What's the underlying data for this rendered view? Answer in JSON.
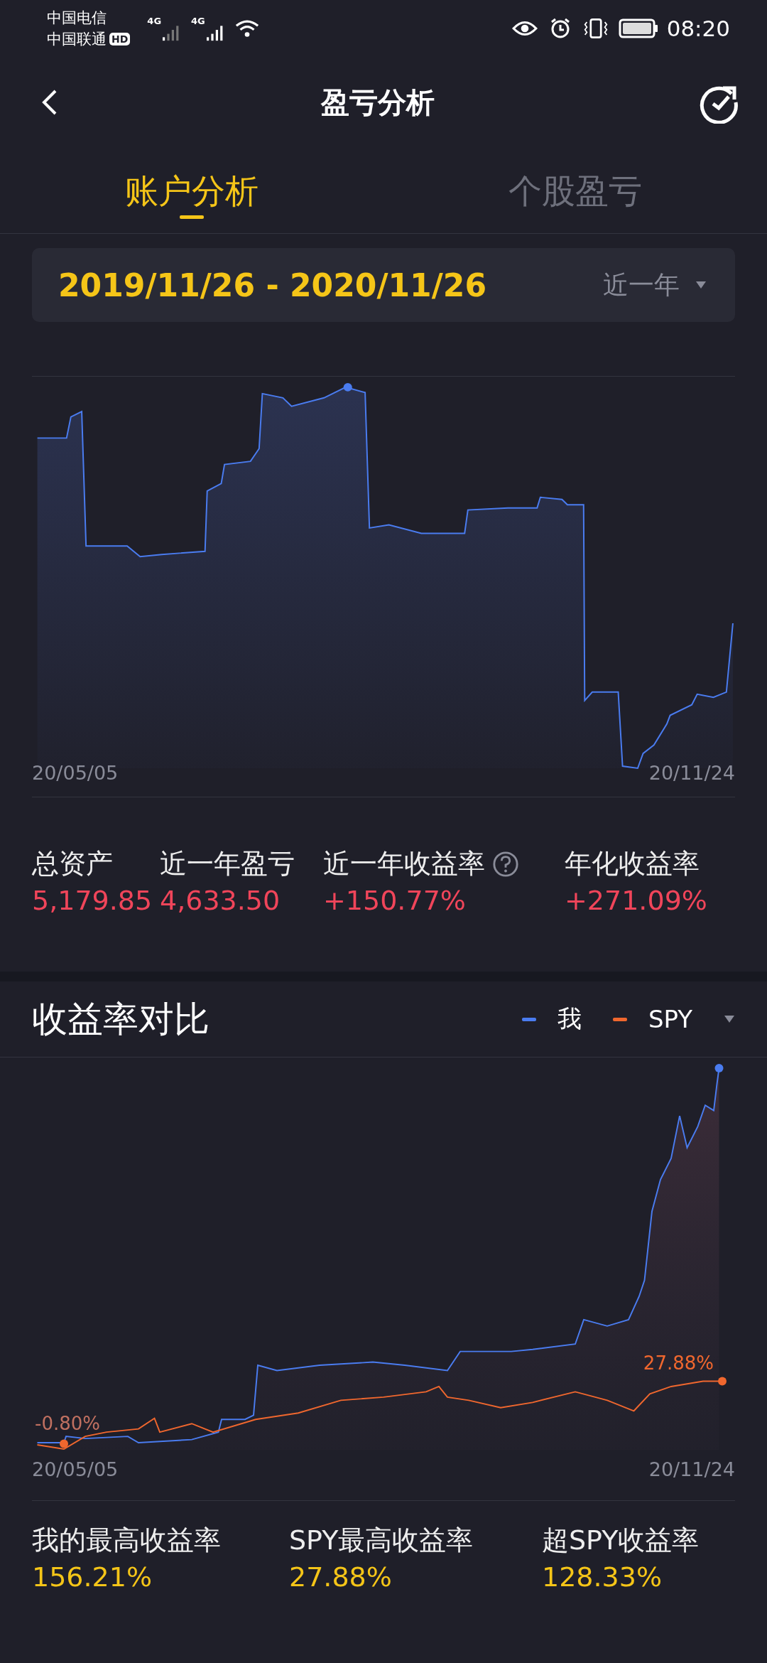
{
  "status_bar": {
    "carrier_1": "中国电信",
    "carrier_2": "中国联通",
    "hd_badge": "HD",
    "network_1": "4G",
    "network_2": "4G",
    "time": "08:20"
  },
  "header": {
    "title": "盈亏分析"
  },
  "tabs": [
    {
      "label": "账户分析",
      "selected": true
    },
    {
      "label": "个股盈亏",
      "selected": false
    }
  ],
  "date_range": {
    "range": "2019/11/26 - 2020/11/26",
    "period": "近一年"
  },
  "account_chart": {
    "x_start": "20/05/05",
    "x_end": "20/11/24"
  },
  "account_stats": [
    {
      "label": "总资产",
      "value": "5,179.85",
      "help": false
    },
    {
      "label": "近一年盈亏",
      "value": "4,633.50",
      "help": false
    },
    {
      "label": "近一年收益率",
      "value": "+150.77%",
      "help": true
    },
    {
      "label": "年化收益率",
      "value": "+271.09%",
      "help": false
    }
  ],
  "comparison": {
    "title": "收益率对比",
    "legend": [
      {
        "label": "我",
        "color": "#4a7cf0"
      },
      {
        "label": "SPY",
        "color": "#f0672e"
      }
    ],
    "start_label": "-0.80%",
    "end_label": "27.88%",
    "x_start": "20/05/05",
    "x_end": "20/11/24"
  },
  "comparison_stats": [
    {
      "label": "我的最高收益率",
      "value": "156.21%"
    },
    {
      "label": "SPY最高收益率",
      "value": "27.88%"
    },
    {
      "label": "超SPY收益率",
      "value": "128.33%"
    }
  ]
}
